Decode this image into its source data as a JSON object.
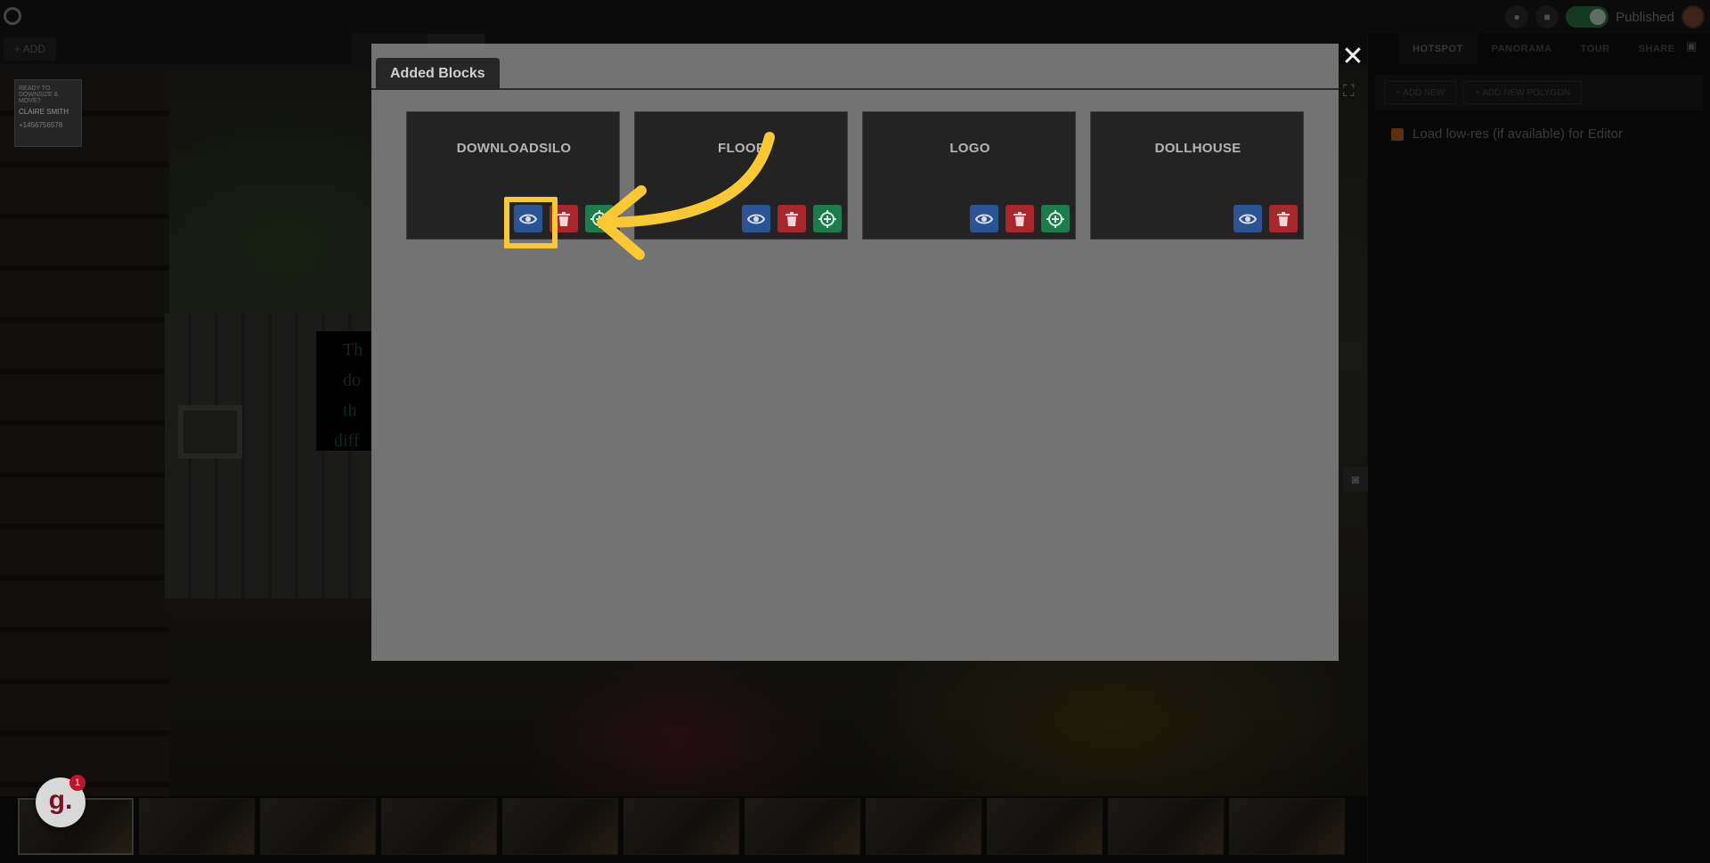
{
  "topbar": {
    "add_label": "+ ADD",
    "published_label": "Published",
    "published_on": true
  },
  "right_panel": {
    "tabs": [
      "HOTSPOT",
      "PANORAMA",
      "TOUR",
      "SHARE"
    ],
    "active_tab": "HOTSPOT",
    "add_new_label": "+ ADD NEW",
    "add_polygon_label": "+ ADD NEW POLYGON",
    "low_res_label": "Load low-res (if available) for Editor",
    "low_res_checked": true
  },
  "scene": {
    "overlay_text_lines": [
      "Th",
      "do",
      "th",
      "diff"
    ],
    "card": {
      "tagline_1": "READY TO",
      "tagline_2": "DOWNSIZE &",
      "tagline_3": "MOVE?",
      "name": "CLAIRE SMITH",
      "phone": "+1456756578"
    }
  },
  "modal": {
    "tab_label": "Added Blocks",
    "close_glyph": "✕",
    "blocks": [
      {
        "title": "DOWNLOADSILO",
        "actions": [
          "view",
          "delete",
          "focus"
        ]
      },
      {
        "title": "FLOOR",
        "actions": [
          "view",
          "delete",
          "focus"
        ]
      },
      {
        "title": "LOGO",
        "actions": [
          "view",
          "delete",
          "focus"
        ]
      },
      {
        "title": "DOLLHOUSE",
        "actions": [
          "view",
          "delete"
        ]
      }
    ]
  },
  "guidde": {
    "logo_letter": "g.",
    "notification_count": "1"
  },
  "colors": {
    "view_button": "#2c5394",
    "delete_button": "#a8272c",
    "focus_button": "#1d7b4c",
    "highlight": "#f9c833"
  },
  "icons": {
    "view": "eye-icon",
    "delete": "trash-icon",
    "focus": "crosshair-plus-icon",
    "close": "close-icon"
  }
}
